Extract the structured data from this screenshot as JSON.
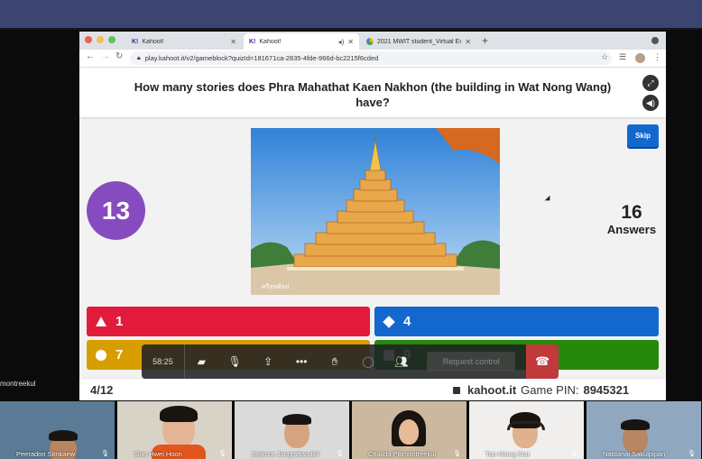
{
  "browser": {
    "tabs": [
      {
        "favicon": "K!",
        "title": "Kahoot!"
      },
      {
        "favicon": "K!",
        "title": "Kahoot!"
      },
      {
        "favicon": "google-drive-icon",
        "title": "2021 MWIT student_Virtual Ex"
      }
    ],
    "url": "play.kahoot.it/v2/gameblock?quizId=181671ca-2835-4fde-966d-bc2215f6cded"
  },
  "kahoot": {
    "question": "How many stories does Phra Mahathat Kaen Nakhon (the building in Wat Nong Wang) have?",
    "skip_label": "Skip",
    "timer": "13",
    "answers_count": "16",
    "answers_label": "Answers",
    "image_watermark": "ศรีสุขศิลป",
    "options": [
      {
        "shape": "triangle",
        "label": "1",
        "color": "#e21b3c"
      },
      {
        "shape": "diamond",
        "label": "4",
        "color": "#1368ce"
      },
      {
        "shape": "circle",
        "label": "7",
        "color": "#d89e00"
      },
      {
        "shape": "square",
        "label": "9",
        "color": "#26890c"
      }
    ],
    "question_index": "4/12",
    "brand": "kahoot.it",
    "game_pin_label": "Game PIN:",
    "game_pin": "8945321"
  },
  "meeting": {
    "elapsed": "58:25",
    "request_control_label": "Request control",
    "side_name": "montreekul",
    "participants": [
      {
        "name": "Peeradon Sitnkaew"
      },
      {
        "name": "Sion Hwei Hoon"
      },
      {
        "name": "Jirakorn Jongrattanakit"
      },
      {
        "name": "Chalida Pitimontreekul"
      },
      {
        "name": "Tan Hiang Kiat"
      },
      {
        "name": "Natdanai Sakulpipan"
      }
    ]
  }
}
